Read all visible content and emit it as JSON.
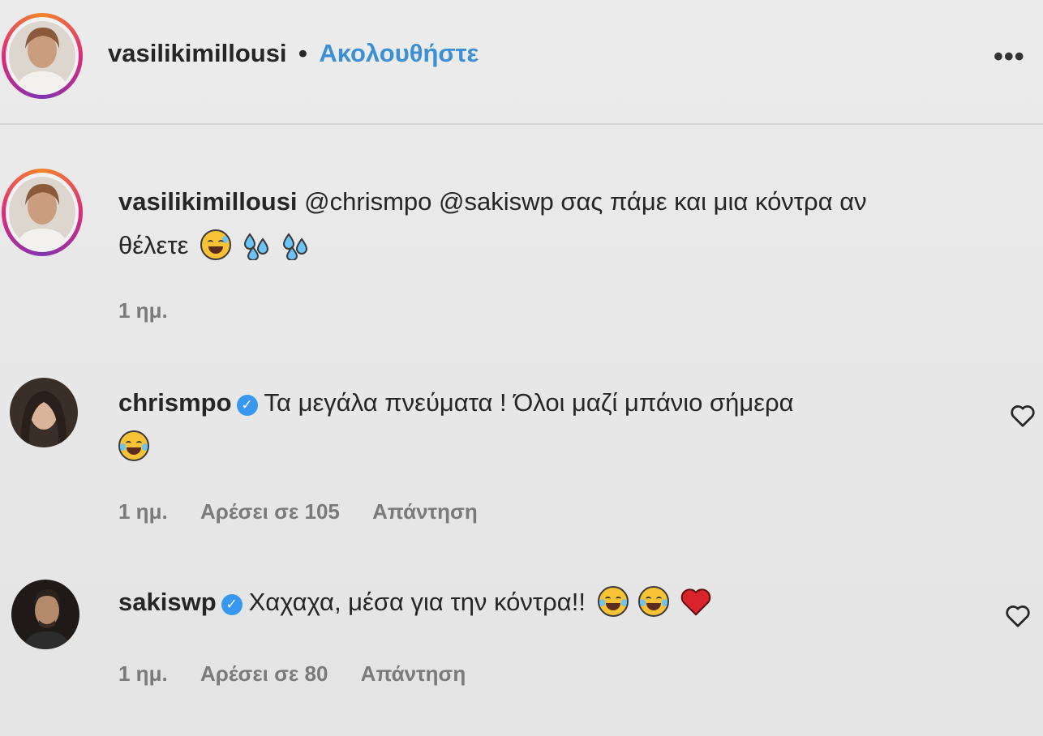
{
  "header": {
    "username": "vasilikimillousi",
    "separator": "•",
    "follow_label": "Ακολουθήστε",
    "more_label": "•••"
  },
  "comments": [
    {
      "username": "vasilikimillousi",
      "line1": "@chrismpo @sakiswp σας πάμε και μια κόντρα αν",
      "line2": "θέλετε",
      "emojis": [
        "grinning-sweat-emoji",
        "sweat-droplets-emoji",
        "sweat-droplets-emoji"
      ],
      "time": "1 ημ.",
      "verified": false
    },
    {
      "username": "chrismpo",
      "line1": "Τα μεγάλα πνεύματα ! Όλοι μαζί μπάνιο σήμερα",
      "emojis": [
        "tears-of-joy-emoji"
      ],
      "time": "1 ημ.",
      "likes": "Αρέσει σε 105",
      "reply": "Απάντηση",
      "verified": true
    },
    {
      "username": "sakiswp",
      "line1": "Χαχαχα, μέσα για την κόντρα!!",
      "emojis": [
        "tears-of-joy-emoji",
        "tears-of-joy-emoji",
        "red-heart-emoji"
      ],
      "time": "1 ημ.",
      "likes": "Αρέσει σε 80",
      "reply": "Απάντηση",
      "verified": true
    }
  ],
  "colors": {
    "follow": "#3a8fd6",
    "verified": "#3897f0",
    "meta": "#7a7a7a"
  }
}
